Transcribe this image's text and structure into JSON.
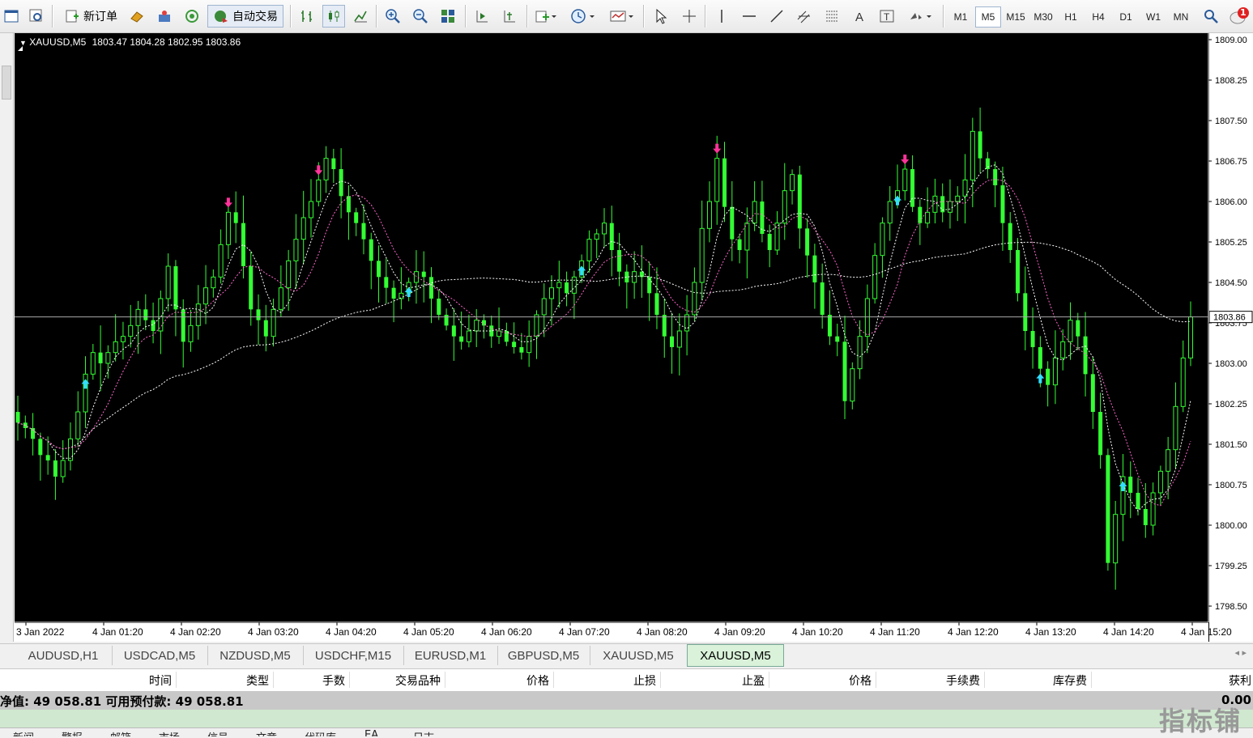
{
  "toolbar": {
    "new_order_label": "新订单",
    "auto_trading_label": "自动交易",
    "timeframes": [
      "M1",
      "M5",
      "M15",
      "M30",
      "H1",
      "H4",
      "D1",
      "W1",
      "MN"
    ],
    "active_timeframe": "M5",
    "notification_count": "1"
  },
  "chart": {
    "symbol_info": "XAUUSD,M5",
    "ohlc": "1803.47 1804.28 1802.95 1803.86",
    "current_price_label": "1803.86",
    "price_axis_labels": [
      "1809.00",
      "1808.25",
      "1807.50",
      "1806.75",
      "1806.00",
      "1805.25",
      "1804.50",
      "1803.75",
      "1803.00",
      "1802.25",
      "1801.50",
      "1800.75",
      "1800.00",
      "1799.25",
      "1798.50"
    ],
    "time_axis_labels": [
      "3 Jan 2022",
      "4 Jan 01:20",
      "4 Jan 02:20",
      "4 Jan 03:20",
      "4 Jan 04:20",
      "4 Jan 05:20",
      "4 Jan 06:20",
      "4 Jan 07:20",
      "4 Jan 08:20",
      "4 Jan 09:20",
      "4 Jan 10:20",
      "4 Jan 11:20",
      "4 Jan 12:20",
      "4 Jan 13:20",
      "4 Jan 14:20",
      "4 Jan 15:20"
    ],
    "colors": {
      "background": "#000000",
      "candle": "#33ff33",
      "wick": "#33ff33",
      "up_arrow": "#33ddff",
      "down_arrow": "#ff3399",
      "ma_line": "#ffffff"
    }
  },
  "chart_data": {
    "type": "candlestick",
    "ylim": [
      1798.3,
      1809.1
    ],
    "close": [
      1801.9,
      1801.8,
      1801.6,
      1801.3,
      1801.2,
      1800.9,
      1801.2,
      1801.6,
      1802.1,
      1802.8,
      1803.2,
      1803.0,
      1803.2,
      1803.4,
      1803.5,
      1803.7,
      1804.0,
      1803.8,
      1803.6,
      1804.2,
      1804.8,
      1804.0,
      1803.4,
      1803.7,
      1804.1,
      1804.4,
      1804.6,
      1805.2,
      1805.8,
      1805.6,
      1804.8,
      1804.0,
      1803.8,
      1803.5,
      1804.0,
      1804.4,
      1804.9,
      1805.3,
      1805.7,
      1806.0,
      1806.4,
      1806.8,
      1806.6,
      1806.1,
      1805.8,
      1805.6,
      1805.3,
      1804.9,
      1804.6,
      1804.4,
      1804.2,
      1804.3,
      1804.5,
      1804.7,
      1804.6,
      1804.2,
      1803.9,
      1803.7,
      1803.5,
      1803.4,
      1803.6,
      1803.8,
      1803.7,
      1803.5,
      1803.6,
      1803.4,
      1803.3,
      1803.2,
      1803.5,
      1803.9,
      1804.2,
      1804.4,
      1804.5,
      1804.3,
      1804.6,
      1804.9,
      1805.3,
      1805.4,
      1805.6,
      1805.1,
      1804.7,
      1804.5,
      1804.7,
      1804.6,
      1804.3,
      1803.9,
      1803.5,
      1803.3,
      1803.6,
      1803.9,
      1804.5,
      1805.5,
      1806.0,
      1806.8,
      1805.9,
      1805.3,
      1805.1,
      1805.6,
      1806.0,
      1805.4,
      1805.1,
      1805.6,
      1806.2,
      1806.5,
      1805.5,
      1805.0,
      1804.5,
      1803.9,
      1803.5,
      1803.4,
      1802.3,
      1802.9,
      1803.5,
      1804.2,
      1805.0,
      1805.6,
      1806.0,
      1806.2,
      1806.6,
      1805.9,
      1805.6,
      1805.8,
      1806.1,
      1805.8,
      1806.0,
      1806.1,
      1806.4,
      1807.3,
      1806.8,
      1806.6,
      1806.3,
      1805.6,
      1805.1,
      1804.3,
      1803.6,
      1803.3,
      1802.9,
      1802.6,
      1803.1,
      1803.4,
      1803.8,
      1803.5,
      1802.8,
      1802.1,
      1801.3,
      1799.3,
      1800.2,
      1800.9,
      1800.6,
      1800.3,
      1800.0,
      1800.6,
      1801.0,
      1801.4,
      1802.2,
      1803.1,
      1803.86
    ]
  },
  "symbol_tabs": [
    "AUDUSD,H1",
    "USDCAD,M5",
    "NZDUSD,M5",
    "USDCHF,M15",
    "EURUSD,M1",
    "GBPUSD,M5",
    "XAUUSD,M5",
    "XAUUSD,M5"
  ],
  "active_symbol_tab": 7,
  "terminal": {
    "columns": [
      "时间",
      "类型",
      "手数",
      "交易品种",
      "价格",
      "止损",
      "止盈",
      "价格",
      "手续费",
      "库存费",
      "获利"
    ],
    "balance_text": "净值: 49 058.81  可用预付款: 49 058.81",
    "profit_value": "0.00"
  },
  "bottom_tabs": [
    "新闻",
    "警报",
    "邮箱",
    "市场",
    "信号",
    "文章",
    "代码库",
    "EA",
    "日志"
  ],
  "watermark": "指标铺"
}
